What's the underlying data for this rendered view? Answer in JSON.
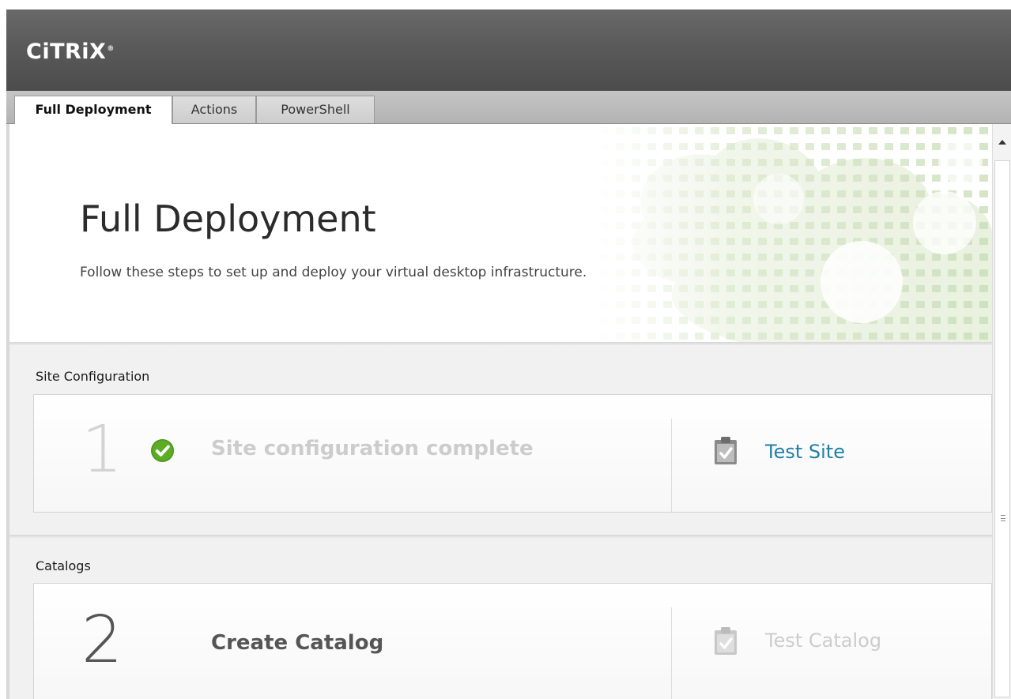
{
  "app": {
    "logo_text": "CiTRiX",
    "logo_mark": "®"
  },
  "tabs": [
    {
      "label": "Full Deployment",
      "active": true
    },
    {
      "label": "Actions",
      "active": false
    },
    {
      "label": "PowerShell",
      "active": false
    }
  ],
  "hero": {
    "title": "Full Deployment",
    "subtitle": "Follow these steps to set up and deploy your virtual desktop infrastructure."
  },
  "sections": [
    {
      "title": "Site Configuration",
      "step_number": "1",
      "step_label": "Site configuration complete",
      "status_icon": "check-circle-icon",
      "action_label": "Test Site",
      "action_icon": "clipboard-check-icon",
      "completed": true,
      "action_enabled": true
    },
    {
      "title": "Catalogs",
      "step_number": "2",
      "step_label": "Create Catalog",
      "action_label": "Test Catalog",
      "action_icon": "clipboard-check-icon",
      "completed": false,
      "action_enabled": false
    }
  ],
  "colors": {
    "header_bg": "#555555",
    "link_blue": "#1e7fa8",
    "check_green": "#4f9a1f",
    "disabled_text": "#cccccc"
  }
}
